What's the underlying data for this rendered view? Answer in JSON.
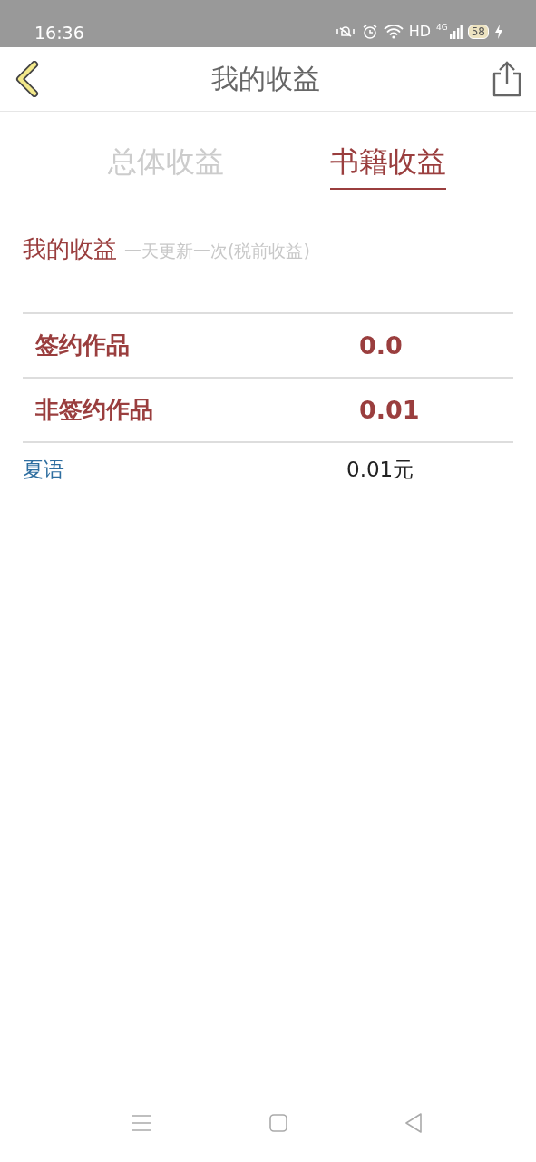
{
  "status_bar": {
    "time": "16:36",
    "network_label": "HD",
    "signal_label": "4G",
    "battery": "58"
  },
  "header": {
    "title": "我的收益"
  },
  "tabs": [
    {
      "label": "总体收益",
      "selected": false
    },
    {
      "label": "书籍收益",
      "selected": true
    }
  ],
  "summary": {
    "title": "我的收益",
    "note": "一天更新一次(税前收益)"
  },
  "income_rows": [
    {
      "label": "签约作品",
      "value": "0.0"
    },
    {
      "label": "非签约作品",
      "value": "0.01"
    }
  ],
  "books": [
    {
      "name": "夏语",
      "amount": "0.01元"
    }
  ]
}
